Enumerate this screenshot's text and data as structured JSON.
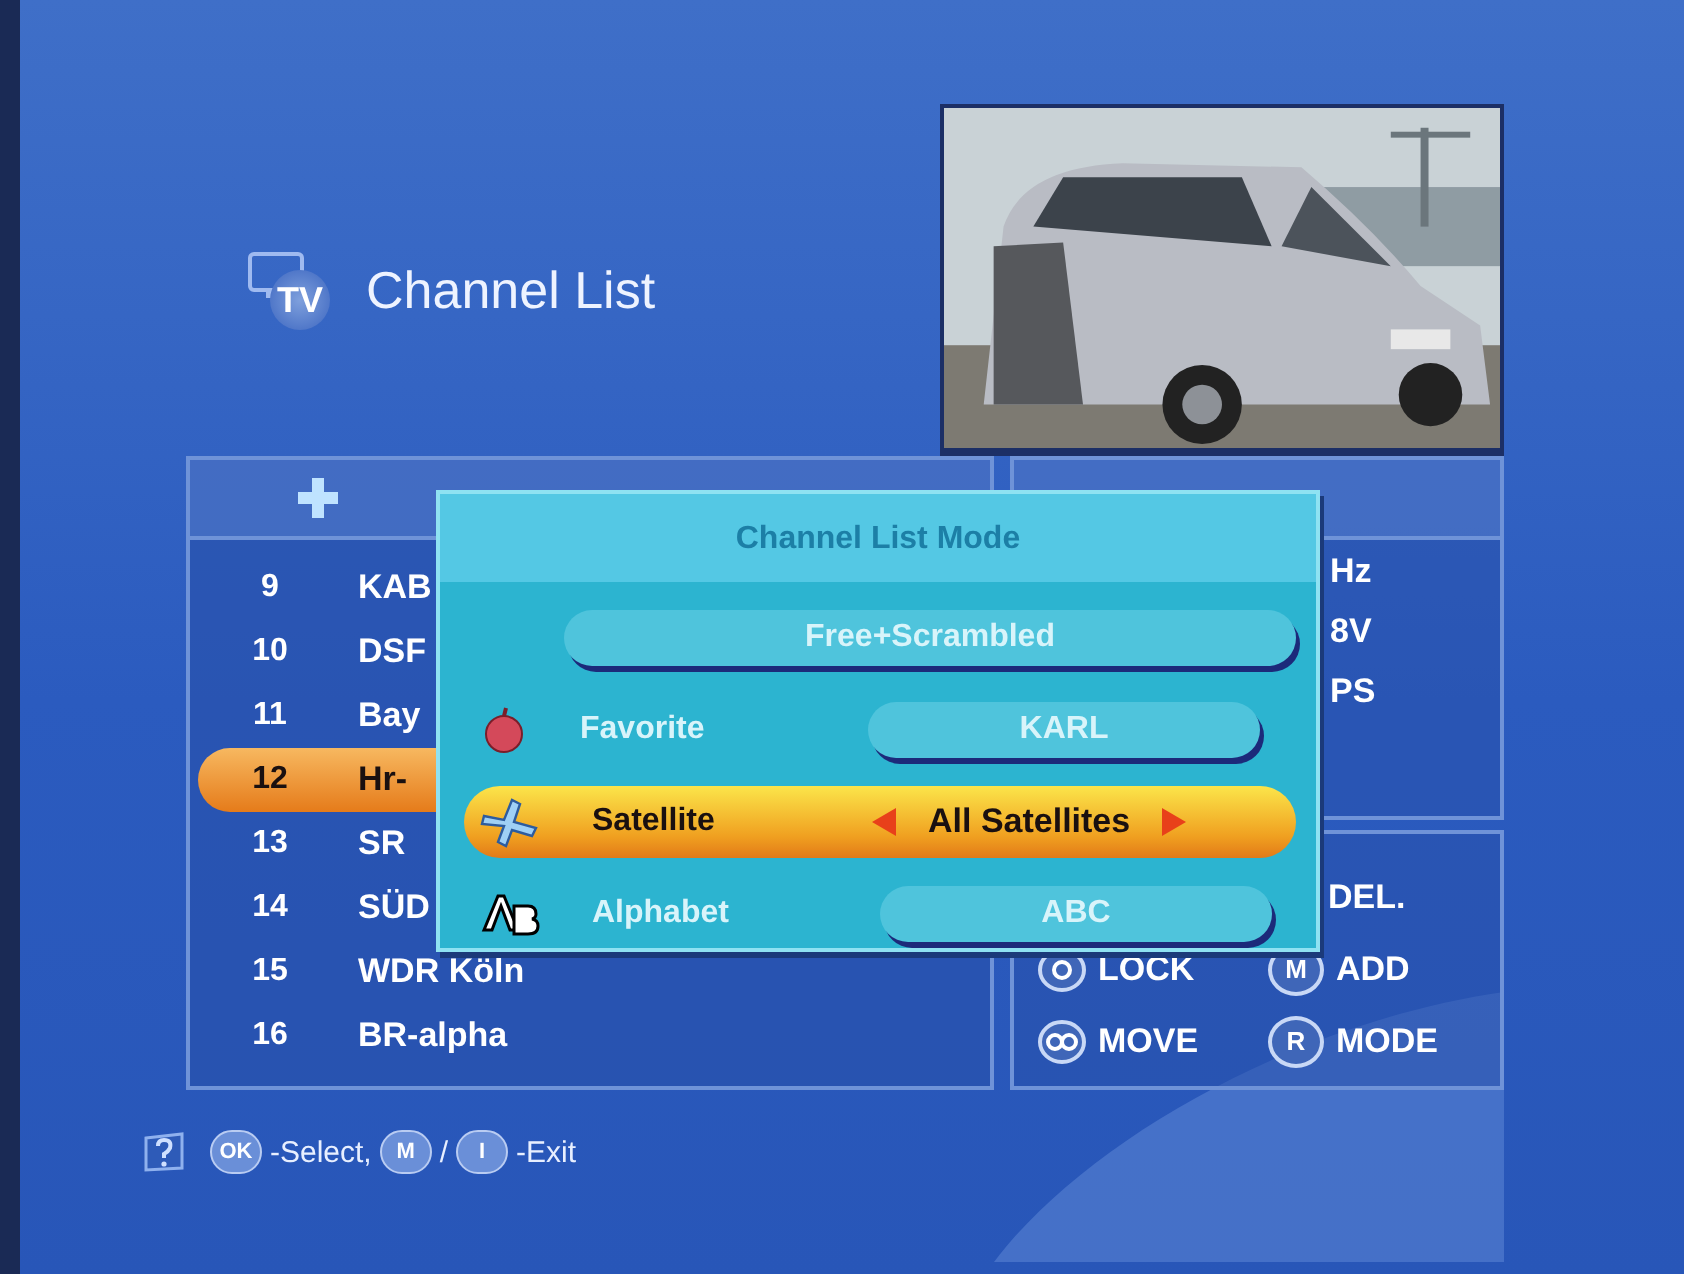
{
  "header": {
    "logo": "TV",
    "title": "Channel List"
  },
  "channel_list": {
    "rows": [
      {
        "number": "9",
        "name": "KAB",
        "selected": false
      },
      {
        "number": "10",
        "name": "DSF",
        "selected": false
      },
      {
        "number": "11",
        "name": "Bay",
        "selected": false
      },
      {
        "number": "12",
        "name": "Hr-",
        "selected": true
      },
      {
        "number": "13",
        "name": "SR",
        "selected": false
      },
      {
        "number": "14",
        "name": "SÜD",
        "selected": false
      },
      {
        "number": "15",
        "name": "WDR Köln",
        "selected": false
      },
      {
        "number": "16",
        "name": "BR-alpha",
        "selected": false
      }
    ]
  },
  "info_panel": {
    "lines": [
      "Hz",
      "8V",
      "PS"
    ]
  },
  "key_panel": {
    "items": [
      {
        "label": "DEL.",
        "kind": "none"
      },
      {
        "label": "LOCK",
        "kind": "round"
      },
      {
        "label": "ADD",
        "kind": "letter",
        "key": "M"
      },
      {
        "label": "MOVE",
        "kind": "loop"
      },
      {
        "label": "MODE",
        "kind": "letter",
        "key": "R"
      }
    ]
  },
  "dialog": {
    "title": "Channel List Mode",
    "rows": [
      {
        "kind": "button",
        "value": "Free+Scrambled",
        "selected": false
      },
      {
        "kind": "option",
        "label": "Favorite",
        "value": "KARL",
        "selected": false
      },
      {
        "kind": "option",
        "label": "Satellite",
        "value": "All Satellites",
        "selected": true
      },
      {
        "kind": "option",
        "label": "Alphabet",
        "value": "ABC",
        "selected": false
      }
    ]
  },
  "footer": [
    {
      "kind": "help"
    },
    {
      "kind": "key",
      "text": "OK"
    },
    {
      "kind": "text",
      "text": "-Select,"
    },
    {
      "kind": "key",
      "text": "M"
    },
    {
      "kind": "text",
      "text": "/"
    },
    {
      "kind": "key",
      "text": "I"
    },
    {
      "kind": "text",
      "text": "-Exit"
    }
  ]
}
